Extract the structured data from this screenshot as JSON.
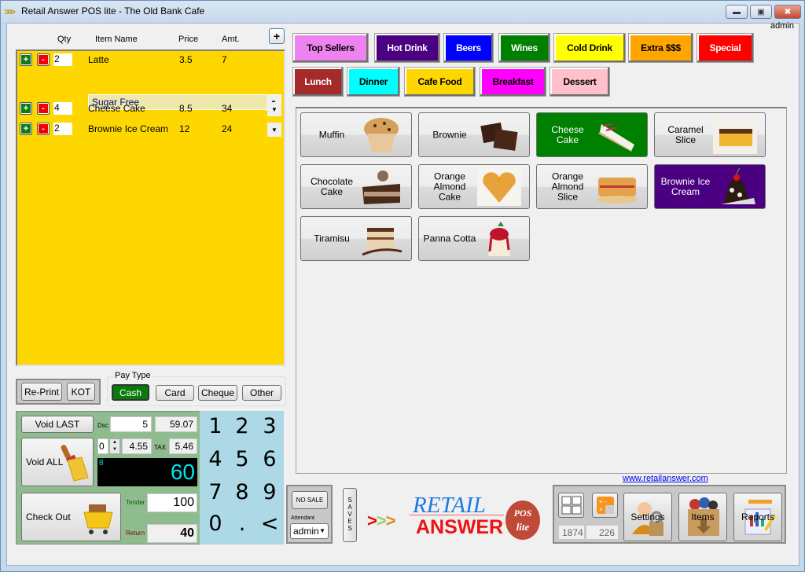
{
  "window": {
    "title": "Retail Answer POS lite - The Old Bank Cafe",
    "user": "admin",
    "controls": [
      "minimize",
      "restore",
      "close"
    ]
  },
  "order": {
    "headers": {
      "qty": "Qty",
      "item": "Item Name",
      "price": "Price",
      "amt": "Amt."
    },
    "add_label": "+",
    "rows": [
      {
        "qty": "2",
        "name": "Latte",
        "price": "3.5",
        "amt": "7",
        "modifier": "Sugar Free"
      },
      {
        "qty": "4",
        "name": "Cheese Cake",
        "price": "8.5",
        "amt": "34"
      },
      {
        "qty": "2",
        "name": "Brownie Ice Cream",
        "price": "12",
        "amt": "24"
      }
    ],
    "plus_label": "+",
    "minus_label": "-"
  },
  "actions": {
    "reprint": "Re-Print",
    "kot": "KOT"
  },
  "pay_type": {
    "legend": "Pay Type",
    "options": [
      "Cash",
      "Card",
      "Cheque",
      "Other"
    ],
    "selected": "Cash"
  },
  "totals": {
    "void_last": "Void LAST",
    "void_all": "Void ALL",
    "check_out": "Check Out",
    "dsc_label": "Dsc",
    "discount": "5",
    "subtotal": "59.07",
    "spinner": "0",
    "tax_base": "4.55",
    "tax_label": "TAX",
    "tax": "5.46",
    "item_count": "8",
    "total": "60",
    "tender_label": "Tender",
    "tender": "100",
    "return_label": "Return",
    "return": "40"
  },
  "keypad": [
    "1",
    "2",
    "3",
    "4",
    "5",
    "6",
    "7",
    "8",
    "9",
    "0",
    ".",
    "<"
  ],
  "categories": [
    {
      "label": "Top Sellers",
      "bg": "#ee82ee",
      "fg": "#000000"
    },
    {
      "label": "Hot Drink",
      "bg": "#4b0082",
      "fg": "#ffffff"
    },
    {
      "label": "Beers",
      "bg": "#0000ff",
      "fg": "#ffffff"
    },
    {
      "label": "Wines",
      "bg": "#008000",
      "fg": "#ffffff"
    },
    {
      "label": "Cold Drink",
      "bg": "#ffff00",
      "fg": "#000000"
    },
    {
      "label": "Extra $$$",
      "bg": "#ffa500",
      "fg": "#000000"
    },
    {
      "label": "Special",
      "bg": "#ff0000",
      "fg": "#ffffff"
    },
    {
      "label": "Lunch",
      "bg": "#a52a2a",
      "fg": "#ffffff"
    },
    {
      "label": "Dinner",
      "bg": "#00ffff",
      "fg": "#000000"
    },
    {
      "label": "Cafe Food",
      "bg": "#ffd700",
      "fg": "#000000"
    },
    {
      "label": "Breakfast",
      "bg": "#ff00ff",
      "fg": "#000000"
    },
    {
      "label": "Dessert",
      "bg": "#ffc0cb",
      "fg": "#000000"
    }
  ],
  "products": [
    {
      "label": "Muffin",
      "icon": "muffin-icon",
      "highlight": null
    },
    {
      "label": "Brownie",
      "icon": "brownie-icon",
      "highlight": null
    },
    {
      "label": "Cheese Cake",
      "icon": "cheesecake-icon",
      "highlight": "#008000"
    },
    {
      "label": "Caramel Slice",
      "icon": "caramel-slice-icon",
      "highlight": null
    },
    {
      "label": "Chocolate Cake",
      "icon": "chocolate-cake-icon",
      "highlight": null
    },
    {
      "label": "Orange Almond Cake",
      "icon": "orange-almond-cake-icon",
      "highlight": null
    },
    {
      "label": "Orange Almond Slice",
      "icon": "orange-almond-slice-icon",
      "highlight": null
    },
    {
      "label": "Brownie Ice Cream",
      "icon": "brownie-ice-cream-icon",
      "highlight": "#4b0082"
    },
    {
      "label": "Tiramisu",
      "icon": "tiramisu-icon",
      "highlight": null
    },
    {
      "label": "Panna Cotta",
      "icon": "panna-cotta-icon",
      "highlight": null
    }
  ],
  "footer": {
    "no_sale": "NO SALE",
    "attendant_label": "Attendant",
    "attendant": "admin",
    "saves": "SAVES",
    "logo_top": "RETAIL",
    "logo_bottom": "ANSWER",
    "logo_badge_1": "POS",
    "logo_badge_2": "lite",
    "url": "www.retailanswer.com",
    "counter_left": "1874",
    "counter_right": "226",
    "settings": "Settings",
    "items": "Items",
    "reports": "Reports"
  }
}
